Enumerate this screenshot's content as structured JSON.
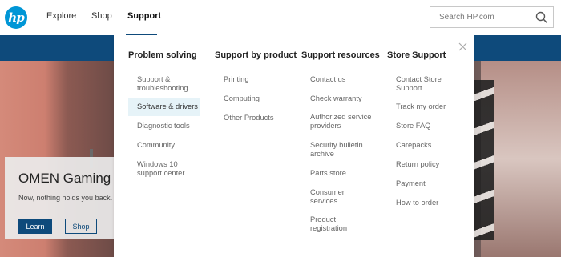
{
  "header": {
    "logo": "hp",
    "nav": [
      "Explore",
      "Shop",
      "Support"
    ],
    "search_placeholder": "Search HP.com"
  },
  "menu": {
    "columns": [
      {
        "title": "Problem solving",
        "items": [
          "Support & troubleshooting",
          "Software & drivers",
          "Diagnostic tools",
          "Community",
          "Windows 10 support center"
        ]
      },
      {
        "title": "Support by product",
        "items": [
          "Printing",
          "Computing",
          "Other Products"
        ]
      },
      {
        "title": "Support resources",
        "items": [
          "Contact us",
          "Check warranty",
          "Authorized service providers",
          "Security bulletin archive",
          "Parts store",
          "Consumer services",
          "Product registration"
        ]
      },
      {
        "title": "Store Support",
        "items": [
          "Contact Store Support",
          "Track my order",
          "Store FAQ",
          "Carepacks",
          "Return policy",
          "Payment",
          "How to order"
        ]
      }
    ]
  },
  "promo": {
    "title": "OMEN Gaming",
    "subtitle": "Now, nothing holds you back.",
    "learn_label": "Learn",
    "shop_label": "Shop"
  },
  "colors": {
    "brand": "#0096d6",
    "nav_blue": "#0e4a7b",
    "highlight": "#e6f3f8"
  }
}
